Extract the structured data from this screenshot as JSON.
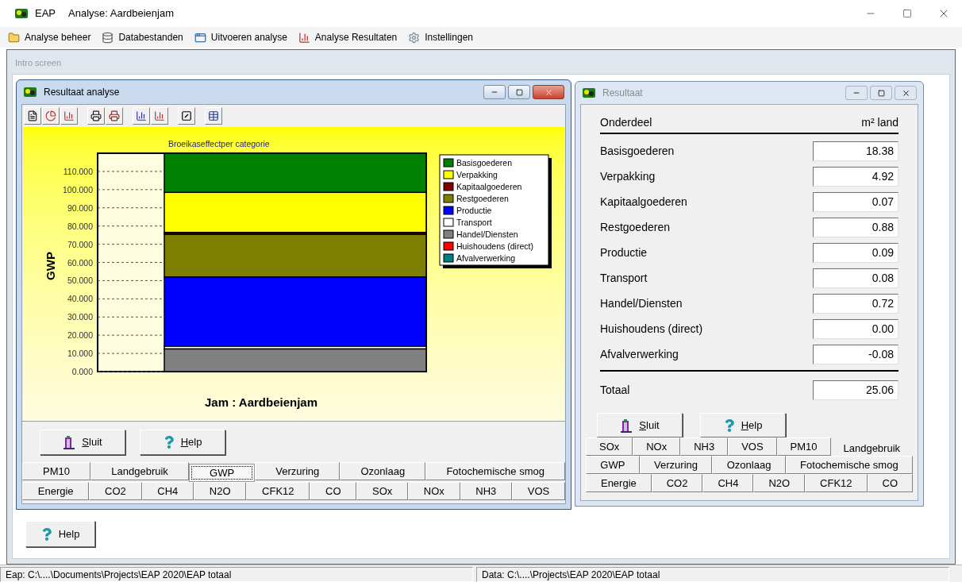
{
  "window": {
    "app": "EAP",
    "title": "Analyse: Aardbeienjam"
  },
  "menu": [
    {
      "label": "Analyse beheer"
    },
    {
      "label": "Databestanden"
    },
    {
      "label": "Uitvoeren analyse"
    },
    {
      "label": "Analyse Resultaten"
    },
    {
      "label": "Instellingen"
    }
  ],
  "mdi": {
    "title": "Intro screen"
  },
  "analysis_window": {
    "title": "Resultaat analyse",
    "active": true,
    "chart_data": {
      "type": "bar",
      "stacked": true,
      "legend": true,
      "title": "Broeikaseffectper categorie",
      "ylabel": "GWP",
      "xlabel": "Jam : Aardbeienjam",
      "ylim": [
        0,
        120
      ],
      "yticks": [
        {
          "value": 0,
          "label": "0.000"
        },
        {
          "value": 10,
          "label": "10.000"
        },
        {
          "value": 20,
          "label": "20.000"
        },
        {
          "value": 30,
          "label": "30.000"
        },
        {
          "value": 40,
          "label": "40.000"
        },
        {
          "value": 50,
          "label": "50.000"
        },
        {
          "value": 60,
          "label": "60.000"
        },
        {
          "value": 70,
          "label": "70.000"
        },
        {
          "value": 80,
          "label": "80.000"
        },
        {
          "value": 90,
          "label": "90.000"
        },
        {
          "value": 100,
          "label": "100.000"
        },
        {
          "value": 110,
          "label": "110.000"
        }
      ],
      "series": [
        {
          "name": "Basisgoederen",
          "color": "#008000",
          "values": [
            21.5
          ]
        },
        {
          "name": "Verpakking",
          "color": "#ffff00",
          "values": [
            22
          ]
        },
        {
          "name": "Kapitaalgoederen",
          "color": "#800000",
          "values": [
            1
          ]
        },
        {
          "name": "Restgoederen",
          "color": "#808000",
          "values": [
            23.5
          ]
        },
        {
          "name": "Productie",
          "color": "#0000ff",
          "values": [
            38
          ]
        },
        {
          "name": "Transport",
          "color": "#ffffff",
          "values": [
            1.5
          ]
        },
        {
          "name": "Handel/Diensten",
          "color": "#808080",
          "values": [
            12.5
          ]
        },
        {
          "name": "Huishoudens (direct)",
          "color": "#ff0000",
          "values": [
            0
          ]
        },
        {
          "name": "Afvalverwerking",
          "color": "#008080",
          "values": [
            0
          ]
        }
      ]
    },
    "buttons": [
      {
        "label": "Sluit",
        "kind": "close",
        "accelerator": true
      },
      {
        "label": "Help",
        "kind": "help",
        "accelerator": true
      }
    ],
    "tab_rows": [
      {
        "tabs": [
          {
            "label": "PM10",
            "selected": false
          },
          {
            "label": "Landgebruik",
            "selected": false
          },
          {
            "label": "GWP",
            "selected": true
          },
          {
            "label": "Verzuring",
            "selected": false
          },
          {
            "label": "Ozonlaag",
            "selected": false
          },
          {
            "label": "Fotochemische smog",
            "selected": false
          }
        ]
      },
      {
        "tabs": [
          {
            "label": "Energie",
            "selected": false
          },
          {
            "label": "CO2",
            "selected": false
          },
          {
            "label": "CH4",
            "selected": false
          },
          {
            "label": "N2O",
            "selected": false
          },
          {
            "label": "CFK12",
            "selected": false
          },
          {
            "label": "CO",
            "selected": false
          },
          {
            "label": "SOx",
            "selected": false
          },
          {
            "label": "NOx",
            "selected": false
          },
          {
            "label": "NH3",
            "selected": false
          },
          {
            "label": "VOS",
            "selected": false
          }
        ]
      }
    ]
  },
  "result_window": {
    "title": "Resultaat",
    "active": false,
    "columns": [
      "Onderdeel",
      "m² land"
    ],
    "rows": [
      {
        "label": "Basisgoederen",
        "value": "18.38"
      },
      {
        "label": "Verpakking",
        "value": "4.92"
      },
      {
        "label": "Kapitaalgoederen",
        "value": "0.07"
      },
      {
        "label": "Restgoederen",
        "value": "0.88"
      },
      {
        "label": "Productie",
        "value": "0.09"
      },
      {
        "label": "Transport",
        "value": "0.08"
      },
      {
        "label": "Handel/Diensten",
        "value": "0.72"
      },
      {
        "label": "Huishoudens (direct)",
        "value": "0.00"
      },
      {
        "label": "Afvalverwerking",
        "value": "-0.08"
      }
    ],
    "total": {
      "label": "Totaal",
      "value": "25.06"
    },
    "buttons": [
      {
        "label": "Sluit",
        "kind": "close",
        "accelerator": true
      },
      {
        "label": "Help",
        "kind": "help",
        "accelerator": true
      }
    ],
    "tab_rows": [
      {
        "tabs": [
          {
            "label": "SOx",
            "selected": false
          },
          {
            "label": "NOx",
            "selected": false
          },
          {
            "label": "NH3",
            "selected": false
          },
          {
            "label": "VOS",
            "selected": false
          },
          {
            "label": "PM10",
            "selected": false
          },
          {
            "label": "Landgebruik",
            "selected": true
          }
        ]
      },
      {
        "tabs": [
          {
            "label": "GWP",
            "selected": false
          },
          {
            "label": "Verzuring",
            "selected": false
          },
          {
            "label": "Ozonlaag",
            "selected": false
          },
          {
            "label": "Fotochemische smog",
            "selected": false
          }
        ]
      },
      {
        "tabs": [
          {
            "label": "Energie",
            "selected": false
          },
          {
            "label": "CO2",
            "selected": false
          },
          {
            "label": "CH4",
            "selected": false
          },
          {
            "label": "N2O",
            "selected": false
          },
          {
            "label": "CFK12",
            "selected": false
          },
          {
            "label": "CO",
            "selected": false
          }
        ]
      }
    ]
  },
  "help_button": {
    "label": "Help",
    "kind": "help",
    "accelerator": false
  },
  "status_bar": [
    "Eap: C:\\....\\Documents\\Projects\\EAP 2020\\EAP totaal",
    "Data: C:\\....\\Projects\\EAP 2020\\EAP totaal"
  ]
}
